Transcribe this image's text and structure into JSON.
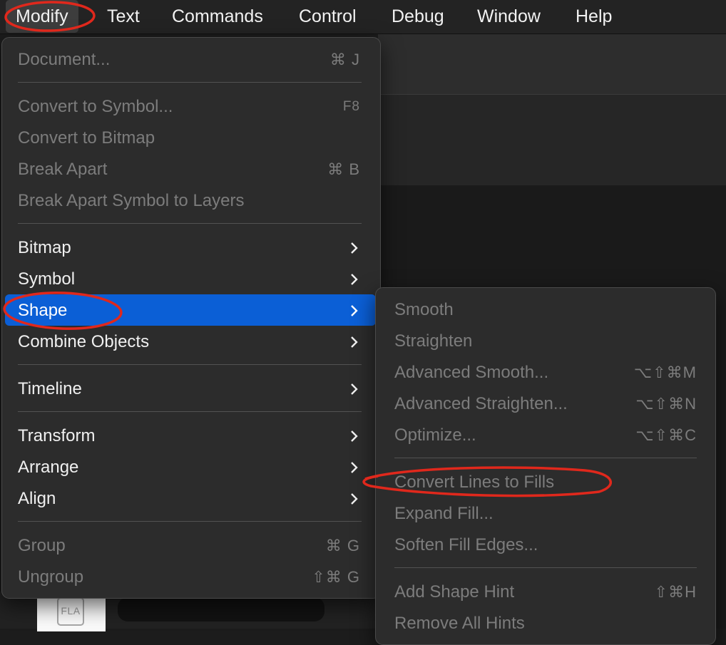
{
  "menubar": {
    "items": [
      "Modify",
      "Text",
      "Commands",
      "Control",
      "Debug",
      "Window",
      "Help"
    ]
  },
  "modify_menu": {
    "items": [
      {
        "label": "Document...",
        "shortcut": "⌘ J",
        "enabled": false
      },
      {
        "label": "Convert to Symbol...",
        "shortcut": "F8",
        "enabled": false
      },
      {
        "label": "Convert to Bitmap",
        "shortcut": "",
        "enabled": false
      },
      {
        "label": "Break Apart",
        "shortcut": "⌘ B",
        "enabled": false
      },
      {
        "label": "Break Apart Symbol to Layers",
        "shortcut": "",
        "enabled": false
      },
      {
        "label": "Bitmap",
        "submenu": true,
        "enabled": true
      },
      {
        "label": "Symbol",
        "submenu": true,
        "enabled": true
      },
      {
        "label": "Shape",
        "submenu": true,
        "enabled": true,
        "highlighted": true
      },
      {
        "label": "Combine Objects",
        "submenu": true,
        "enabled": true
      },
      {
        "label": "Timeline",
        "submenu": true,
        "enabled": true
      },
      {
        "label": "Transform",
        "submenu": true,
        "enabled": true
      },
      {
        "label": "Arrange",
        "submenu": true,
        "enabled": true
      },
      {
        "label": "Align",
        "submenu": true,
        "enabled": true
      },
      {
        "label": "Group",
        "shortcut": "⌘ G",
        "enabled": false
      },
      {
        "label": "Ungroup",
        "shortcut": "⇧⌘ G",
        "enabled": false
      }
    ]
  },
  "shape_submenu": {
    "items": [
      {
        "label": "Smooth",
        "shortcut": "",
        "enabled": false
      },
      {
        "label": "Straighten",
        "shortcut": "",
        "enabled": false
      },
      {
        "label": "Advanced Smooth...",
        "shortcut": "⌥⇧⌘M",
        "enabled": false
      },
      {
        "label": "Advanced Straighten...",
        "shortcut": "⌥⇧⌘N",
        "enabled": false
      },
      {
        "label": "Optimize...",
        "shortcut": "⌥⇧⌘C",
        "enabled": false
      },
      {
        "label": "Convert Lines to Fills",
        "shortcut": "",
        "enabled": false
      },
      {
        "label": "Expand Fill...",
        "shortcut": "",
        "enabled": false
      },
      {
        "label": "Soften Fill Edges...",
        "shortcut": "",
        "enabled": false
      },
      {
        "label": "Add Shape Hint",
        "shortcut": "⇧⌘H",
        "enabled": false
      },
      {
        "label": "Remove All Hints",
        "shortcut": "",
        "enabled": false
      }
    ]
  },
  "background": {
    "file_icon_label": "FLA"
  },
  "colors": {
    "highlight": "#0b5fd6",
    "annotation": "#e0281c",
    "disabled_text": "#7c7c7c",
    "enabled_text": "#f0f0f0"
  }
}
